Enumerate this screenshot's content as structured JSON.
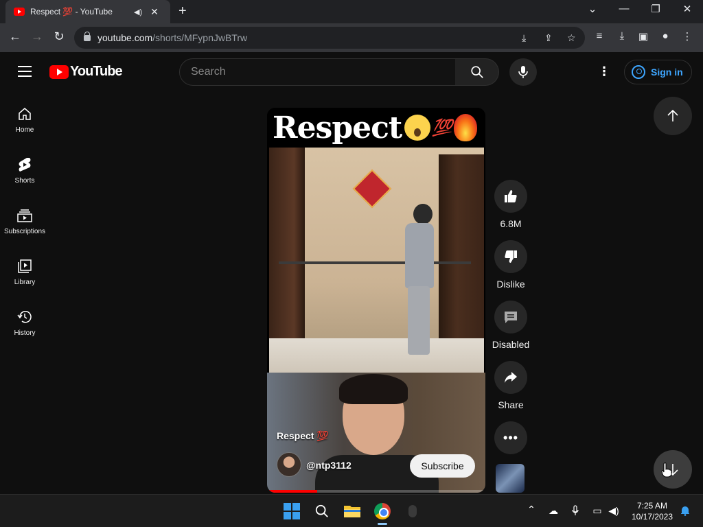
{
  "browser": {
    "tab_title": "Respect 💯 - YouTube",
    "url_domain": "youtube.com",
    "url_path": "/shorts/MFypnJwBTrw"
  },
  "header": {
    "logo_text": "YouTube",
    "search_placeholder": "Search",
    "signin_label": "Sign in"
  },
  "sidebar": {
    "items": [
      {
        "label": "Home",
        "icon": "home-icon"
      },
      {
        "label": "Shorts",
        "icon": "shorts-icon"
      },
      {
        "label": "Subscriptions",
        "icon": "subscriptions-icon"
      },
      {
        "label": "Library",
        "icon": "library-icon"
      },
      {
        "label": "History",
        "icon": "history-icon"
      }
    ]
  },
  "short": {
    "overlay_title": "Respect",
    "title": "Respect 💯",
    "channel": "@ntp3112",
    "subscribe_label": "Subscribe",
    "progress_fraction": 0.23
  },
  "actions": {
    "likes": "6.8M",
    "dislike": "Dislike",
    "comments": "Disabled",
    "share": "Share"
  },
  "taskbar": {
    "time": "7:25 AM",
    "date": "10/17/2023"
  },
  "colors": {
    "accent_red": "#ff0000",
    "link_blue": "#3ea6ff",
    "background": "#0f0f0f"
  }
}
